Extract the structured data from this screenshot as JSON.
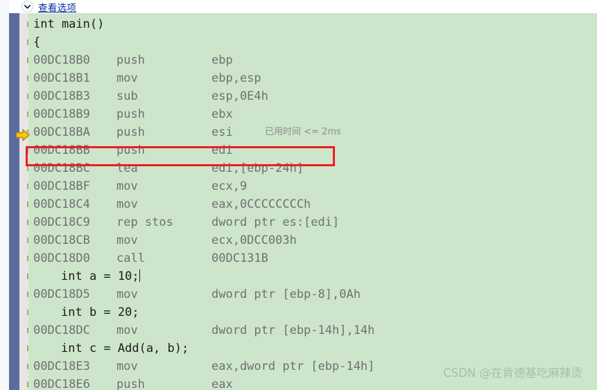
{
  "header": {
    "chevron_icon": "chevron-down-icon",
    "view_options_label": "查看选项"
  },
  "colors": {
    "code_background": "#cde6cb",
    "gutter": "#e6e6e6",
    "left_bar": "#5a6b9e",
    "link": "#0b2ea0",
    "highlight_border": "#ed1c24",
    "arrow_fill": "#f5c518",
    "asm_text": "#6e7070",
    "source_text": "#1b1b1b",
    "timing_text": "#8c8c8c",
    "watermark": "#a9bca8"
  },
  "markers": {
    "execution_arrow_icon": "execution-pointer-arrow-icon",
    "execution_arrow_line_index": 6,
    "highlight_line_index": 7,
    "timing_label": "已用时间 <= 2ms",
    "timing_line_index": 6
  },
  "watermark": "CSDN @在肯德基吃麻辣烫",
  "lines": [
    {
      "kind": "source",
      "indent": false,
      "text": "int main()"
    },
    {
      "kind": "source",
      "indent": false,
      "text": "{"
    },
    {
      "kind": "asm",
      "addr": "00DC18B0",
      "mnem": "push",
      "oper": "ebp"
    },
    {
      "kind": "asm",
      "addr": "00DC18B1",
      "mnem": "mov",
      "oper": "ebp,esp"
    },
    {
      "kind": "asm",
      "addr": "00DC18B3",
      "mnem": "sub",
      "oper": "esp,0E4h"
    },
    {
      "kind": "asm",
      "addr": "00DC18B9",
      "mnem": "push",
      "oper": "ebx"
    },
    {
      "kind": "asm",
      "addr": "00DC18BA",
      "mnem": "push",
      "oper": "esi"
    },
    {
      "kind": "asm",
      "addr": "00DC18BB",
      "mnem": "push",
      "oper": "edi"
    },
    {
      "kind": "asm",
      "addr": "00DC18BC",
      "mnem": "lea",
      "oper": "edi,[ebp-24h]"
    },
    {
      "kind": "asm",
      "addr": "00DC18BF",
      "mnem": "mov",
      "oper": "ecx,9"
    },
    {
      "kind": "asm",
      "addr": "00DC18C4",
      "mnem": "mov",
      "oper": "eax,0CCCCCCCCh"
    },
    {
      "kind": "asm",
      "addr": "00DC18C9",
      "mnem": "rep stos",
      "oper": "dword ptr es:[edi]"
    },
    {
      "kind": "asm",
      "addr": "00DC18CB",
      "mnem": "mov",
      "oper": "ecx,0DCC003h"
    },
    {
      "kind": "asm",
      "addr": "00DC18D0",
      "mnem": "call",
      "oper": "00DC131B"
    },
    {
      "kind": "source",
      "indent": true,
      "text": "int a = 10;",
      "caret": true
    },
    {
      "kind": "asm",
      "addr": "00DC18D5",
      "mnem": "mov",
      "oper": "dword ptr [ebp-8],0Ah"
    },
    {
      "kind": "source",
      "indent": true,
      "text": "int b = 20;"
    },
    {
      "kind": "asm",
      "addr": "00DC18DC",
      "mnem": "mov",
      "oper": "dword ptr [ebp-14h],14h"
    },
    {
      "kind": "source",
      "indent": true,
      "text": "int c = Add(a, b);"
    },
    {
      "kind": "asm",
      "addr": "00DC18E3",
      "mnem": "mov",
      "oper": "eax,dword ptr [ebp-14h]"
    },
    {
      "kind": "asm",
      "addr": "00DC18E6",
      "mnem": "push",
      "oper": "eax"
    }
  ]
}
